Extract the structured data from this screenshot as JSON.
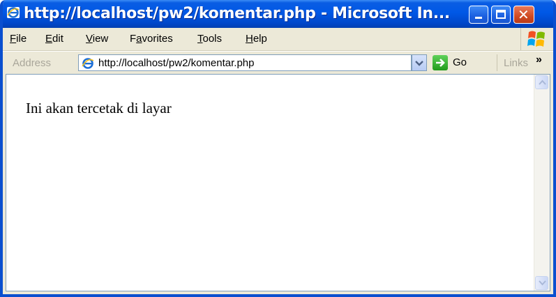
{
  "window": {
    "title": "http://localhost/pw2/komentar.php - Microsoft In..."
  },
  "menu": {
    "items": [
      {
        "first": "F",
        "rest": "ile",
        "underline_first": true
      },
      {
        "first": "E",
        "rest": "dit",
        "underline_first": true
      },
      {
        "first": "V",
        "rest": "iew",
        "underline_first": true
      },
      {
        "first": "Fa",
        "rest": "vorites",
        "underline_pos": 1
      },
      {
        "first": "T",
        "rest": "ools",
        "underline_first": true
      },
      {
        "first": "H",
        "rest": "elp",
        "underline_first": true
      }
    ]
  },
  "address": {
    "label": "Address",
    "url": "http://localhost/pw2/komentar.php",
    "go_label": "Go",
    "links_label": "Links",
    "links_chevron": "»"
  },
  "page": {
    "text": "Ini akan tercetak di layar"
  },
  "colors": {
    "titlebar": "#0058e6",
    "chrome": "#ece9d8",
    "go_green": "#219b1b"
  },
  "icons": {
    "title": "ie-icon",
    "address": "ie-icon",
    "go": "go-arrow-icon",
    "logo": "windows-xp-logo"
  }
}
